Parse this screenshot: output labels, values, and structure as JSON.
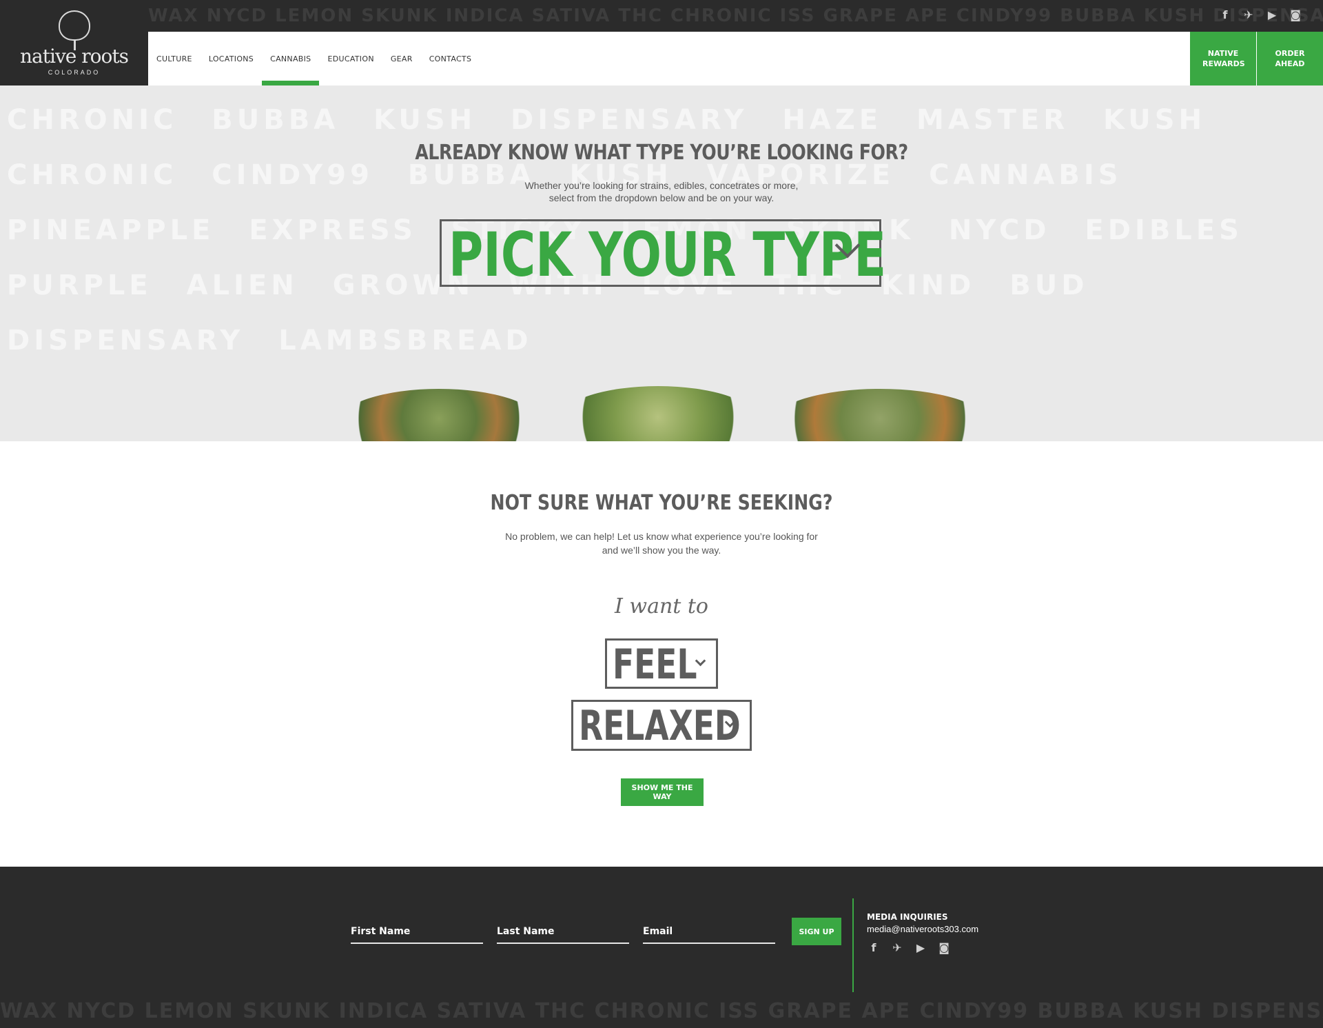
{
  "brand": {
    "name": "native roots",
    "tagline": "COLORADO"
  },
  "header": {
    "social_icons": [
      "facebook-icon",
      "twitter-icon",
      "youtube-icon",
      "instagram-icon"
    ],
    "nav": [
      "CULTURE",
      "LOCATIONS",
      "CANNABIS",
      "EDUCATION",
      "GEAR",
      "CONTACTS"
    ],
    "active_nav": "CANNABIS",
    "cta_rewards": "NATIVE REWARDS",
    "cta_order": "ORDER AHEAD"
  },
  "hero": {
    "title": "ALREADY KNOW WHAT TYPE YOU’RE LOOKING FOR?",
    "subtitle_line1": "Whether you’re looking for strains, edibles, concetrates or more,",
    "subtitle_line2": "select from the dropdown below and be on your way.",
    "dropdown_value": "PICK YOUR TYPE"
  },
  "finder": {
    "title": "NOT SURE WHAT YOU’RE SEEKING?",
    "subtitle_line1": "No problem, we can help! Let us know what experience you’re looking for",
    "subtitle_line2": "and we’ll show you the way.",
    "lead": "I want to",
    "verb_value": "FEEL",
    "effect_value": "RELAXED",
    "button": "SHOW ME THE WAY"
  },
  "footer": {
    "first_name": "First Name",
    "last_name": "Last Name",
    "email": "Email",
    "signup": "SIGN UP",
    "media_heading": "MEDIA INQUIRIES",
    "media_email": "media@nativeroots303.com",
    "social_icons": [
      "facebook-icon",
      "twitter-icon",
      "youtube-icon",
      "instagram-icon"
    ]
  },
  "colors": {
    "accent": "#3aa843",
    "dark": "#2b2b2b",
    "hero_bg": "#e9e9e9",
    "text": "#5c5c5c"
  }
}
